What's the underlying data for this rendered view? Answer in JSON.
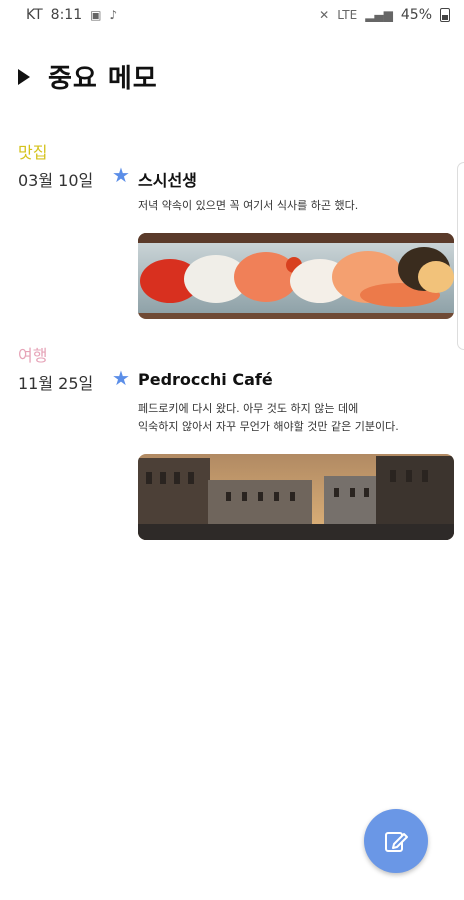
{
  "status_bar": {
    "carrier": "KT",
    "time": "8:11",
    "network": "LTE",
    "battery_percent": "45%"
  },
  "header": {
    "title": "중요 메모"
  },
  "memos": [
    {
      "category": "맛집",
      "category_color": "#d4c21c",
      "date": "03월 10일",
      "title": "스시선생",
      "body": "저녁 약속이 있으면 꼭 여기서 식사를 하곤 했다.",
      "image": "sushi-image"
    },
    {
      "category": "여행",
      "category_color": "#e6a3b7",
      "date": "11월 25일",
      "title": "Pedrocchi Café",
      "body_line1": "페드로키에 다시 왔다. 아무 것도 하지 않는 데에",
      "body_line2": "익숙하지 않아서 자꾸 무언가 해야할 것만 같은 기분이다.",
      "image": "venice-street-image"
    }
  ],
  "fab": {
    "icon": "edit-icon",
    "color": "#6a97e6"
  }
}
